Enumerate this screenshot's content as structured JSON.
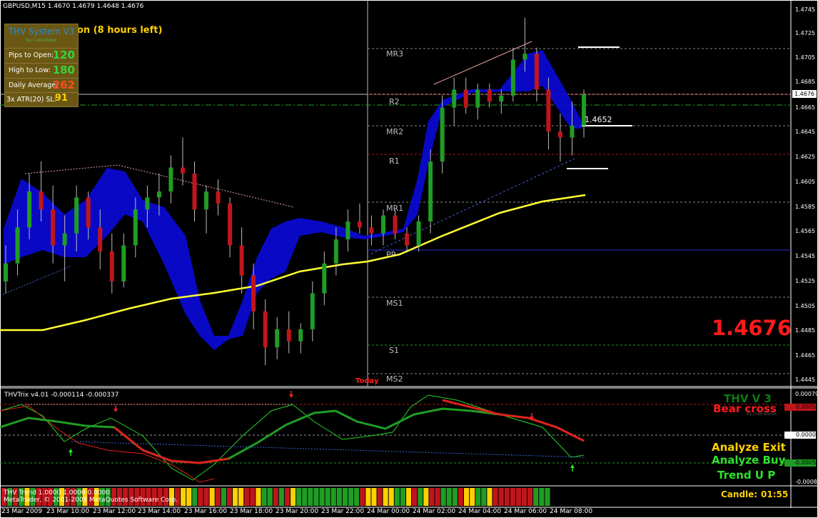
{
  "window": {
    "symbol_header": "GBPUSD,M15  1.4670 1.4679 1.4648 1.4676",
    "session_text": "on (8 hours left)",
    "copyright": "MetaTrader, © 2001-2008 MetaQuotes Software Corp."
  },
  "panel": {
    "title": "THV System V3",
    "subtitle": "by Cobraforex",
    "rows": [
      {
        "label": "Pips to Open:",
        "value": "120",
        "color": "#34d43a"
      },
      {
        "label": "High to Low:",
        "value": "180",
        "color": "#34d43a"
      },
      {
        "label": "Daily Average:",
        "value": "262",
        "color": "#ff4a1f"
      },
      {
        "label": "3x ATR(20) SL:",
        "value": "91",
        "color": "#ffd000"
      }
    ]
  },
  "price_scale": [
    "1.4745",
    "1.4725",
    "1.4705",
    "1.4685",
    "1.4665",
    "1.4645",
    "1.4625",
    "1.4605",
    "1.4585",
    "1.4565",
    "1.4545",
    "1.4525",
    "1.4505",
    "1.4485",
    "1.4465",
    "1.4445"
  ],
  "current_price_tag": "1.4676",
  "big_price": "1.4676",
  "price_marker": "1.4652",
  "pivot_levels": [
    "MR3",
    "R2",
    "MR2",
    "R1",
    "MR1",
    "PP",
    "MS1",
    "S1",
    "MS2"
  ],
  "today_label": "Today",
  "indicator": {
    "header": "THVTrix v4.01 -0.000114 -0.000337",
    "scale": [
      "0.00079",
      "0.0005",
      "0.0000",
      "-0.0005",
      "-0.00087"
    ],
    "thv_label": "THV V 3",
    "thv_sub": "by Cobraforex",
    "cross_label": "Bear cross",
    "signals": [
      "Analyze Exit",
      "Analyze Buy",
      "Trend U P"
    ]
  },
  "trend_bar": {
    "label": "THV Trend  1.0000 1.0000 0.0000",
    "candle_label": "Candle:",
    "candle_time": "01:55"
  },
  "time_axis": [
    "23 Mar 2009",
    "23 Mar 10:00",
    "23 Mar 12:00",
    "23 Mar 14:00",
    "23 Mar 16:00",
    "23 Mar 18:00",
    "23 Mar 20:00",
    "23 Mar 22:00",
    "24 Mar 00:00",
    "24 Mar 02:00",
    "24 Mar 04:00",
    "24 Mar 06:00",
    "24 Mar 08:00"
  ],
  "colors": {
    "bull": "#1f9d24",
    "bear": "#c0151b",
    "cloud": "#0a0ad6",
    "ma": "#ffff33",
    "accent_red": "#ff1a1a",
    "accent_yellow": "#ffd000",
    "accent_green": "#2fe02f"
  },
  "chart_data": {
    "type": "candlestick",
    "price_range": [
      1.444,
      1.475
    ],
    "candles_ohlc": [
      [
        1.452,
        1.455,
        1.451,
        1.4535
      ],
      [
        1.4535,
        1.458,
        1.4525,
        1.4565
      ],
      [
        1.4565,
        1.461,
        1.4555,
        1.4595
      ],
      [
        1.4595,
        1.462,
        1.457,
        1.458
      ],
      [
        1.458,
        1.46,
        1.4535,
        1.455
      ],
      [
        1.455,
        1.4575,
        1.452,
        1.456
      ],
      [
        1.456,
        1.46,
        1.4545,
        1.459
      ],
      [
        1.459,
        1.4595,
        1.4555,
        1.4565
      ],
      [
        1.4565,
        1.458,
        1.453,
        1.4545
      ],
      [
        1.4545,
        1.456,
        1.451,
        1.452
      ],
      [
        1.452,
        1.456,
        1.4515,
        1.455
      ],
      [
        1.455,
        1.459,
        1.454,
        1.458
      ],
      [
        1.458,
        1.46,
        1.4565,
        1.459
      ],
      [
        1.459,
        1.461,
        1.4575,
        1.4595
      ],
      [
        1.4595,
        1.4625,
        1.4585,
        1.4615
      ],
      [
        1.4615,
        1.464,
        1.46,
        1.461
      ],
      [
        1.461,
        1.462,
        1.457,
        1.458
      ],
      [
        1.458,
        1.46,
        1.456,
        1.4595
      ],
      [
        1.4595,
        1.4605,
        1.4575,
        1.4585
      ],
      [
        1.4585,
        1.459,
        1.454,
        1.455
      ],
      [
        1.455,
        1.4565,
        1.451,
        1.4525
      ],
      [
        1.4525,
        1.4535,
        1.448,
        1.4495
      ],
      [
        1.4495,
        1.4505,
        1.445,
        1.4465
      ],
      [
        1.4465,
        1.449,
        1.4455,
        1.448
      ],
      [
        1.448,
        1.4495,
        1.446,
        1.447
      ],
      [
        1.447,
        1.4485,
        1.446,
        1.448
      ],
      [
        1.448,
        1.452,
        1.447,
        1.451
      ],
      [
        1.451,
        1.4545,
        1.45,
        1.4535
      ],
      [
        1.4535,
        1.4565,
        1.4525,
        1.4555
      ],
      [
        1.4555,
        1.458,
        1.4545,
        1.457
      ],
      [
        1.457,
        1.4585,
        1.456,
        1.4565
      ],
      [
        1.4565,
        1.4575,
        1.455,
        1.456
      ],
      [
        1.456,
        1.458,
        1.455,
        1.4575
      ],
      [
        1.4575,
        1.458,
        1.4555,
        1.456
      ],
      [
        1.456,
        1.4565,
        1.4545,
        1.455
      ],
      [
        1.455,
        1.4575,
        1.4545,
        1.457
      ],
      [
        1.457,
        1.463,
        1.456,
        1.462
      ],
      [
        1.462,
        1.4675,
        1.461,
        1.4665
      ],
      [
        1.4665,
        1.469,
        1.465,
        1.468
      ],
      [
        1.468,
        1.469,
        1.466,
        1.4665
      ],
      [
        1.4665,
        1.4685,
        1.4655,
        1.468
      ],
      [
        1.468,
        1.4685,
        1.4665,
        1.467
      ],
      [
        1.467,
        1.468,
        1.466,
        1.4675
      ],
      [
        1.4675,
        1.4715,
        1.467,
        1.4705
      ],
      [
        1.4705,
        1.474,
        1.4695,
        1.471
      ],
      [
        1.471,
        1.4715,
        1.467,
        1.468
      ],
      [
        1.468,
        1.469,
        1.463,
        1.4645
      ],
      [
        1.4645,
        1.466,
        1.462,
        1.464
      ],
      [
        1.464,
        1.467,
        1.4625,
        1.465
      ],
      [
        1.465,
        1.468,
        1.464,
        1.4676
      ]
    ]
  }
}
